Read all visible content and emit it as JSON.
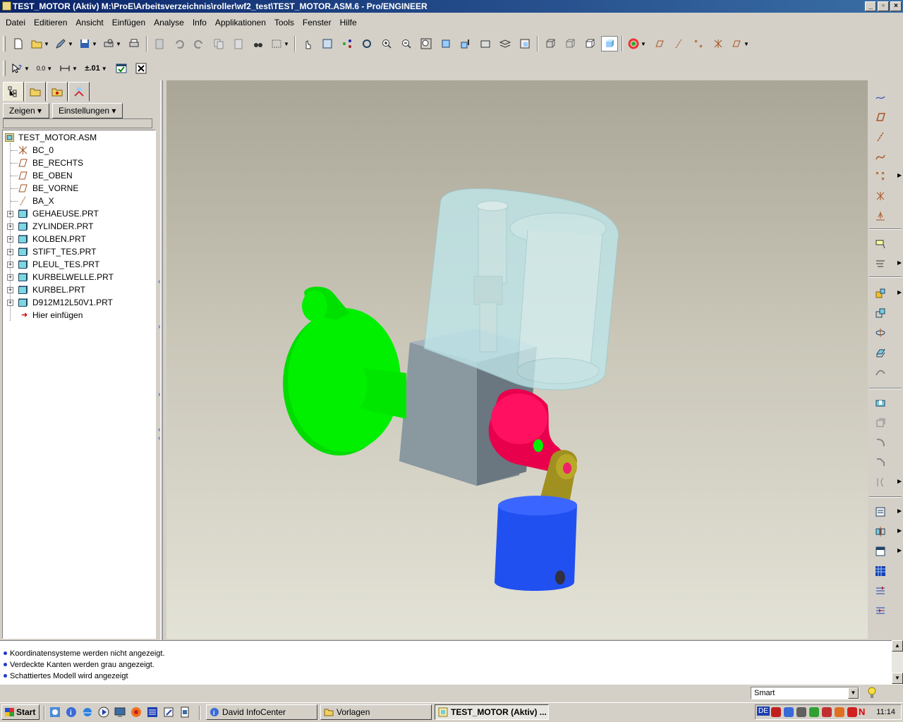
{
  "window": {
    "title": "TEST_MOTOR (Aktiv) M:\\ProE\\Arbeitsverzeichnis\\roller\\wf2_test\\TEST_MOTOR.ASM.6 - Pro/ENGINEER",
    "min_label": "_",
    "max_label": "▫",
    "close_label": "×"
  },
  "menu": [
    {
      "label": "Datei"
    },
    {
      "label": "Editieren"
    },
    {
      "label": "Ansicht"
    },
    {
      "label": "Einfügen"
    },
    {
      "label": "Analyse"
    },
    {
      "label": "Info"
    },
    {
      "label": "Applikationen"
    },
    {
      "label": "Tools"
    },
    {
      "label": "Fenster"
    },
    {
      "label": "Hilfe"
    }
  ],
  "toolbar2": {
    "tolerance_label": "±.01",
    "dim_label": "0.0"
  },
  "tree": {
    "show_button": "Zeigen",
    "settings_button": "Einstellungen",
    "root": "TEST_MOTOR.ASM",
    "items": [
      {
        "label": "BC_0",
        "icon": "csys-icon"
      },
      {
        "label": "BE_RECHTS",
        "icon": "datum-plane-icon"
      },
      {
        "label": "BE_OBEN",
        "icon": "datum-plane-icon"
      },
      {
        "label": "BE_VORNE",
        "icon": "datum-plane-icon"
      },
      {
        "label": "BA_X",
        "icon": "datum-axis-icon"
      },
      {
        "label": "GEHAEUSE.PRT",
        "icon": "part-icon"
      },
      {
        "label": "ZYLINDER.PRT",
        "icon": "part-icon"
      },
      {
        "label": "KOLBEN.PRT",
        "icon": "part-icon"
      },
      {
        "label": "STIFT_TES.PRT",
        "icon": "part-icon"
      },
      {
        "label": "PLEUL_TES.PRT",
        "icon": "part-icon"
      },
      {
        "label": "KURBELWELLE.PRT",
        "icon": "part-icon"
      },
      {
        "label": "KURBEL.PRT",
        "icon": "part-icon"
      },
      {
        "label": "D912M12L50V1.PRT",
        "icon": "part-icon"
      }
    ],
    "insert_here": "Hier einfügen"
  },
  "messages": [
    "Koordinatensysteme werden nicht angezeigt.",
    "Verdeckte Kanten werden grau angezeigt.",
    "Schattiertes Modell wird angezeigt"
  ],
  "status": {
    "filter_value": "Smart"
  },
  "taskbar": {
    "start_label": "Start",
    "tasks": [
      {
        "label": "David InfoCenter"
      },
      {
        "label": "Vorlagen"
      },
      {
        "label": "TEST_MOTOR (Aktiv) ..."
      }
    ],
    "tray_lang": "DE",
    "clock": "11:14"
  },
  "colors": {
    "shaft_green": "#00f000",
    "crank_pink": "#f01060",
    "rod_olive": "#a0901a",
    "piston_blue": "#2050f0",
    "block_gray": "#7a8890",
    "cylinder_transparent": "#b8e4e8"
  }
}
